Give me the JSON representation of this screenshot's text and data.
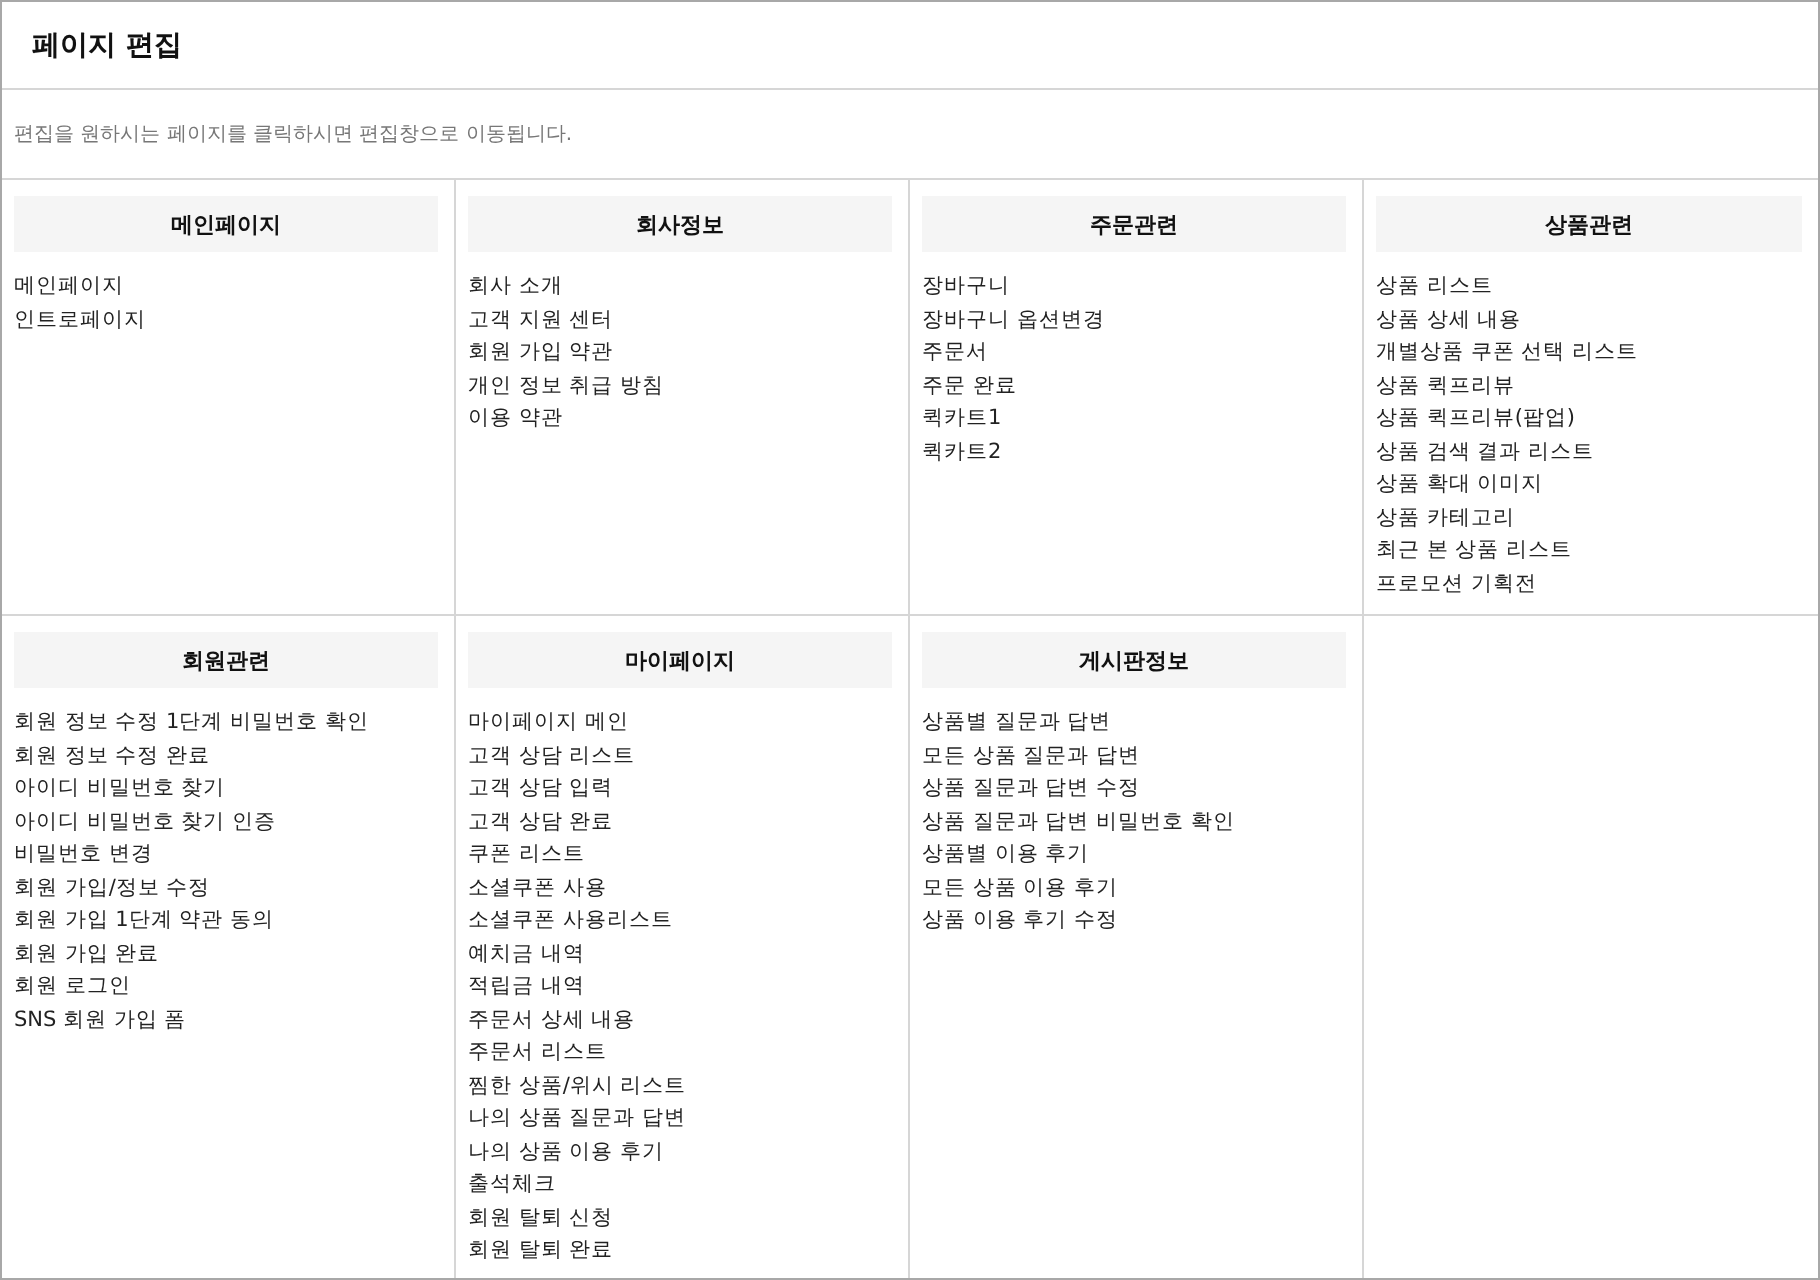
{
  "title": "페이지 편집",
  "description": "편집을 원하시는 페이지를 클릭하시면 편집창으로 이동됩니다.",
  "sections": [
    {
      "heading": "메인페이지",
      "items": [
        "메인페이지",
        "인트로페이지"
      ]
    },
    {
      "heading": "회사정보",
      "items": [
        "회사 소개",
        "고객 지원 센터",
        "회원 가입 약관",
        "개인 정보 취급 방침",
        "이용 약관"
      ]
    },
    {
      "heading": "주문관련",
      "items": [
        "장바구니",
        "장바구니 옵션변경",
        "주문서",
        "주문 완료",
        "퀵카트1",
        "퀵카트2"
      ]
    },
    {
      "heading": "상품관련",
      "items": [
        "상품 리스트",
        "상품 상세 내용",
        "개별상품 쿠폰 선택 리스트",
        "상품 퀵프리뷰",
        "상품 퀵프리뷰(팝업)",
        "상품 검색 결과 리스트",
        "상품 확대 이미지",
        "상품 카테고리",
        "최근 본 상품 리스트",
        "프로모션 기획전"
      ]
    },
    {
      "heading": "회원관련",
      "items": [
        "회원 정보 수정 1단계 비밀번호 확인",
        "회원 정보 수정 완료",
        "아이디 비밀번호 찾기",
        "아이디 비밀번호 찾기 인증",
        "비밀번호 변경",
        "회원 가입/정보 수정",
        "회원 가입 1단계 약관 동의",
        "회원 가입 완료",
        "회원 로그인",
        "SNS 회원 가입 폼"
      ]
    },
    {
      "heading": "마이페이지",
      "items": [
        "마이페이지 메인",
        "고객 상담 리스트",
        "고객 상담 입력",
        "고객 상담 완료",
        "쿠폰 리스트",
        "소셜쿠폰 사용",
        "소셜쿠폰 사용리스트",
        "예치금 내역",
        "적립금 내역",
        "주문서 상세 내용",
        "주문서 리스트",
        "찜한 상품/위시 리스트",
        "나의 상품 질문과 답변",
        "나의 상품 이용 후기",
        "출석체크",
        "회원 탈퇴 신청",
        "회원 탈퇴 완료"
      ]
    },
    {
      "heading": "게시판정보",
      "items": [
        "상품별 질문과 답변",
        "모든 상품 질문과 답변",
        "상품 질문과 답변 수정",
        "상품 질문과 답변 비밀번호 확인",
        "상품별 이용 후기",
        "모든 상품 이용 후기",
        "상품 이용 후기 수정"
      ]
    }
  ]
}
